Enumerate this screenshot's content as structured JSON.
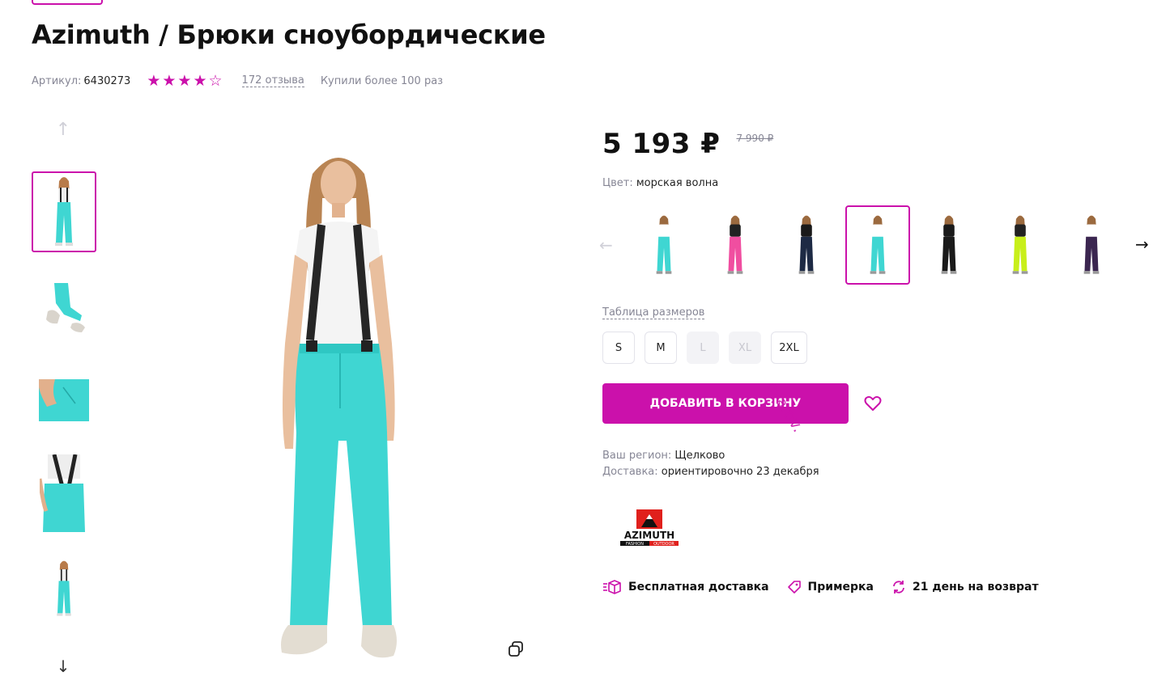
{
  "product": {
    "title": "Azimuth / Брюки сноубордические",
    "sku_label": "Артикул:",
    "sku": "6430273",
    "rating": 4,
    "reviews": "172 отзыва",
    "bought": "Купили более 100 раз"
  },
  "price": {
    "current": "5 193 ₽",
    "old": "7 990 ₽"
  },
  "color": {
    "label": "Цвет:",
    "value": "морская волна"
  },
  "variants": [
    {
      "name": "turquoise",
      "pants": "#3fd6d2",
      "top": "#ffffff",
      "selected": false
    },
    {
      "name": "pink",
      "pants": "#f04ea0",
      "top": "#222222",
      "selected": false
    },
    {
      "name": "navy",
      "pants": "#1d2a44",
      "top": "#1a1a1a",
      "selected": false
    },
    {
      "name": "turquoise-selected",
      "pants": "#3fd6d2",
      "top": "#ffffff",
      "selected": true
    },
    {
      "name": "black",
      "pants": "#1a1a1a",
      "top": "#1a1a1a",
      "selected": false
    },
    {
      "name": "lime",
      "pants": "#c8ef1a",
      "top": "#222222",
      "selected": false
    },
    {
      "name": "purple",
      "pants": "#3b2650",
      "top": "#ffffff",
      "selected": false
    }
  ],
  "sizes": {
    "table_label": "Таблица размеров",
    "items": [
      {
        "label": "S",
        "available": true
      },
      {
        "label": "M",
        "available": true
      },
      {
        "label": "L",
        "available": false
      },
      {
        "label": "XL",
        "available": false
      },
      {
        "label": "2XL",
        "available": true
      }
    ]
  },
  "actions": {
    "add_to_cart": "ДОБАВИТЬ В КОРЗИНУ",
    "watermark": "ovarov."
  },
  "delivery": {
    "region_label": "Ваш регион:",
    "region": "Щелково",
    "delivery_label": "Доставка:",
    "delivery": "ориентировочно 23 декабря"
  },
  "brand": {
    "name": "AZIMUTH",
    "tagline_left": "FASHION",
    "tagline_right": "OUTDOOR"
  },
  "features": [
    {
      "icon": "delivery-box-icon",
      "label": "Бесплатная доставка"
    },
    {
      "icon": "tag-icon",
      "label": "Примерка"
    },
    {
      "icon": "refresh-icon",
      "label": "21 день на возврат"
    }
  ],
  "colors": {
    "accent": "#cb11ab",
    "muted": "#868695"
  }
}
